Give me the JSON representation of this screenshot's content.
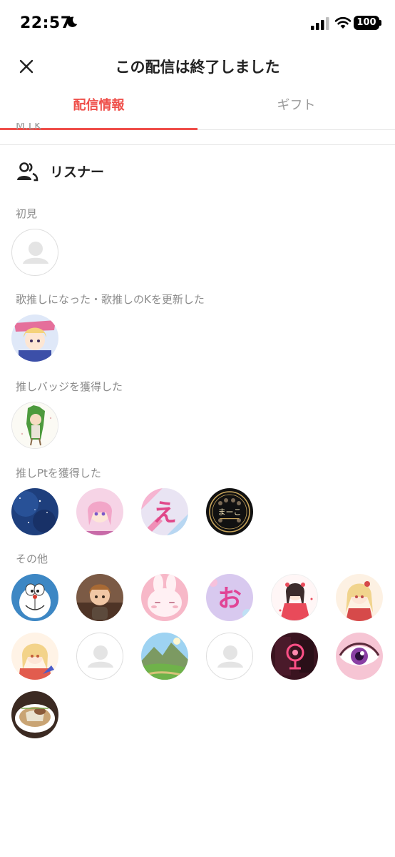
{
  "status_bar": {
    "time": "22:57",
    "battery": "100"
  },
  "header": {
    "title": "この配信は終了しました"
  },
  "tabs": [
    {
      "label": "配信情報",
      "active": true
    },
    {
      "label": "ギフト",
      "active": false
    }
  ],
  "cut_text": "M.LK",
  "listeners": {
    "title": "リスナー",
    "groups": [
      {
        "label": "初見"
      },
      {
        "label": "歌推しになった・歌推しのKを更新した"
      },
      {
        "label": "推しバッジを獲得した"
      },
      {
        "label": "推しPtを獲得した"
      },
      {
        "label": "その他"
      }
    ],
    "gold_badge_text": "まーこ"
  },
  "colors": {
    "accent": "#ef4f4a",
    "muted_text": "#8c8c8c",
    "divider": "#e6e6e6"
  }
}
